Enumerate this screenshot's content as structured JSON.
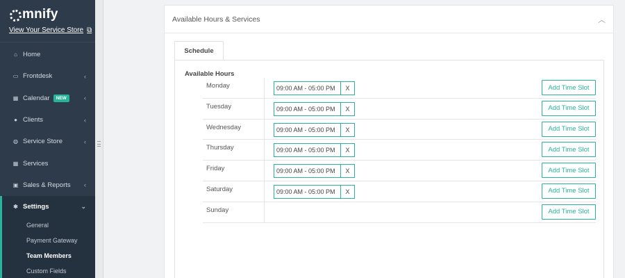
{
  "brand": {
    "logo_text": "mnify",
    "store_link": "View Your Service Store"
  },
  "sidebar": {
    "items": [
      {
        "label": "Home",
        "icon": "home-icon",
        "glyph": "⌂",
        "chevron": ""
      },
      {
        "label": "Frontdesk",
        "icon": "monitor-icon",
        "glyph": "▭",
        "chevron": "‹"
      },
      {
        "label": "Calendar",
        "icon": "calendar-icon",
        "glyph": "▦",
        "chevron": "‹",
        "badge": "NEW"
      },
      {
        "label": "Clients",
        "icon": "user-icon",
        "glyph": "●",
        "chevron": "‹"
      },
      {
        "label": "Service Store",
        "icon": "globe-icon",
        "glyph": "◍",
        "chevron": "‹"
      },
      {
        "label": "Services",
        "icon": "grid-icon",
        "glyph": "▦",
        "chevron": ""
      },
      {
        "label": "Sales & Reports",
        "icon": "money-icon",
        "glyph": "▣",
        "chevron": "‹"
      },
      {
        "label": "Settings",
        "icon": "gear-icon",
        "glyph": "✱",
        "chevron": "⌄"
      }
    ],
    "sub_items": [
      {
        "label": "General"
      },
      {
        "label": "Payment Gateway"
      },
      {
        "label": "Team Members"
      },
      {
        "label": "Custom Fields"
      }
    ]
  },
  "panel": {
    "title": "Available Hours & Services",
    "tab_label": "Schedule",
    "section_label": "Available Hours",
    "add_label": "Add Time Slot",
    "remove_label": "X",
    "days": [
      {
        "day": "Monday",
        "slot": "09:00 AM - 05:00 PM"
      },
      {
        "day": "Tuesday",
        "slot": "09:00 AM - 05:00 PM"
      },
      {
        "day": "Wednesday",
        "slot": "09:00 AM - 05:00 PM"
      },
      {
        "day": "Thursday",
        "slot": "09:00 AM - 05:00 PM"
      },
      {
        "day": "Friday",
        "slot": "09:00 AM - 05:00 PM"
      },
      {
        "day": "Saturday",
        "slot": "09:00 AM - 05:00 PM"
      },
      {
        "day": "Sunday",
        "slot": ""
      }
    ]
  },
  "colors": {
    "accent": "#27b49a",
    "sidebar_bg": "#2d3b4a"
  }
}
